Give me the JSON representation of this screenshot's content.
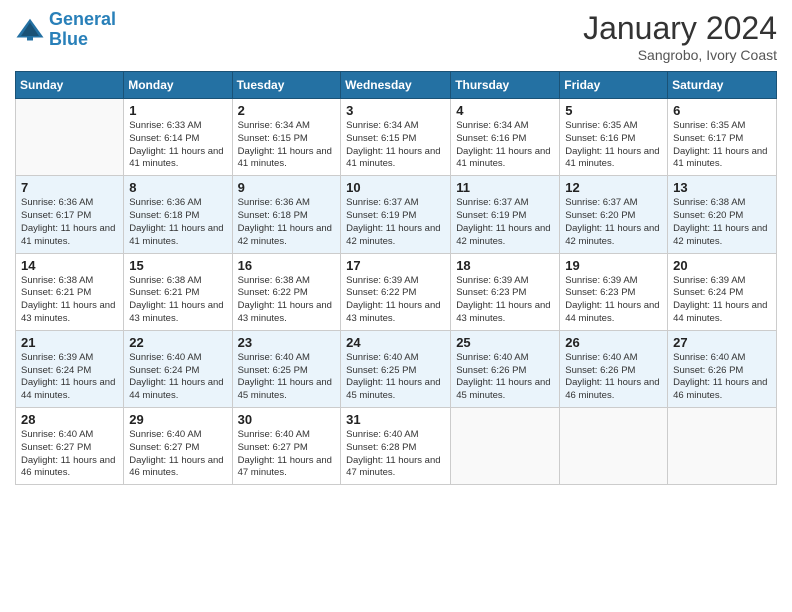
{
  "logo": {
    "line1": "General",
    "line2": "Blue"
  },
  "title": "January 2024",
  "subtitle": "Sangrobo, Ivory Coast",
  "headers": [
    "Sunday",
    "Monday",
    "Tuesday",
    "Wednesday",
    "Thursday",
    "Friday",
    "Saturday"
  ],
  "weeks": [
    {
      "shaded": false,
      "days": [
        {
          "num": "",
          "info": ""
        },
        {
          "num": "1",
          "info": "Sunrise: 6:33 AM\nSunset: 6:14 PM\nDaylight: 11 hours\nand 41 minutes."
        },
        {
          "num": "2",
          "info": "Sunrise: 6:34 AM\nSunset: 6:15 PM\nDaylight: 11 hours\nand 41 minutes."
        },
        {
          "num": "3",
          "info": "Sunrise: 6:34 AM\nSunset: 6:15 PM\nDaylight: 11 hours\nand 41 minutes."
        },
        {
          "num": "4",
          "info": "Sunrise: 6:34 AM\nSunset: 6:16 PM\nDaylight: 11 hours\nand 41 minutes."
        },
        {
          "num": "5",
          "info": "Sunrise: 6:35 AM\nSunset: 6:16 PM\nDaylight: 11 hours\nand 41 minutes."
        },
        {
          "num": "6",
          "info": "Sunrise: 6:35 AM\nSunset: 6:17 PM\nDaylight: 11 hours\nand 41 minutes."
        }
      ]
    },
    {
      "shaded": true,
      "days": [
        {
          "num": "7",
          "info": "Sunrise: 6:36 AM\nSunset: 6:17 PM\nDaylight: 11 hours\nand 41 minutes."
        },
        {
          "num": "8",
          "info": "Sunrise: 6:36 AM\nSunset: 6:18 PM\nDaylight: 11 hours\nand 41 minutes."
        },
        {
          "num": "9",
          "info": "Sunrise: 6:36 AM\nSunset: 6:18 PM\nDaylight: 11 hours\nand 42 minutes."
        },
        {
          "num": "10",
          "info": "Sunrise: 6:37 AM\nSunset: 6:19 PM\nDaylight: 11 hours\nand 42 minutes."
        },
        {
          "num": "11",
          "info": "Sunrise: 6:37 AM\nSunset: 6:19 PM\nDaylight: 11 hours\nand 42 minutes."
        },
        {
          "num": "12",
          "info": "Sunrise: 6:37 AM\nSunset: 6:20 PM\nDaylight: 11 hours\nand 42 minutes."
        },
        {
          "num": "13",
          "info": "Sunrise: 6:38 AM\nSunset: 6:20 PM\nDaylight: 11 hours\nand 42 minutes."
        }
      ]
    },
    {
      "shaded": false,
      "days": [
        {
          "num": "14",
          "info": "Sunrise: 6:38 AM\nSunset: 6:21 PM\nDaylight: 11 hours\nand 43 minutes."
        },
        {
          "num": "15",
          "info": "Sunrise: 6:38 AM\nSunset: 6:21 PM\nDaylight: 11 hours\nand 43 minutes."
        },
        {
          "num": "16",
          "info": "Sunrise: 6:38 AM\nSunset: 6:22 PM\nDaylight: 11 hours\nand 43 minutes."
        },
        {
          "num": "17",
          "info": "Sunrise: 6:39 AM\nSunset: 6:22 PM\nDaylight: 11 hours\nand 43 minutes."
        },
        {
          "num": "18",
          "info": "Sunrise: 6:39 AM\nSunset: 6:23 PM\nDaylight: 11 hours\nand 43 minutes."
        },
        {
          "num": "19",
          "info": "Sunrise: 6:39 AM\nSunset: 6:23 PM\nDaylight: 11 hours\nand 44 minutes."
        },
        {
          "num": "20",
          "info": "Sunrise: 6:39 AM\nSunset: 6:24 PM\nDaylight: 11 hours\nand 44 minutes."
        }
      ]
    },
    {
      "shaded": true,
      "days": [
        {
          "num": "21",
          "info": "Sunrise: 6:39 AM\nSunset: 6:24 PM\nDaylight: 11 hours\nand 44 minutes."
        },
        {
          "num": "22",
          "info": "Sunrise: 6:40 AM\nSunset: 6:24 PM\nDaylight: 11 hours\nand 44 minutes."
        },
        {
          "num": "23",
          "info": "Sunrise: 6:40 AM\nSunset: 6:25 PM\nDaylight: 11 hours\nand 45 minutes."
        },
        {
          "num": "24",
          "info": "Sunrise: 6:40 AM\nSunset: 6:25 PM\nDaylight: 11 hours\nand 45 minutes."
        },
        {
          "num": "25",
          "info": "Sunrise: 6:40 AM\nSunset: 6:26 PM\nDaylight: 11 hours\nand 45 minutes."
        },
        {
          "num": "26",
          "info": "Sunrise: 6:40 AM\nSunset: 6:26 PM\nDaylight: 11 hours\nand 46 minutes."
        },
        {
          "num": "27",
          "info": "Sunrise: 6:40 AM\nSunset: 6:26 PM\nDaylight: 11 hours\nand 46 minutes."
        }
      ]
    },
    {
      "shaded": false,
      "days": [
        {
          "num": "28",
          "info": "Sunrise: 6:40 AM\nSunset: 6:27 PM\nDaylight: 11 hours\nand 46 minutes."
        },
        {
          "num": "29",
          "info": "Sunrise: 6:40 AM\nSunset: 6:27 PM\nDaylight: 11 hours\nand 46 minutes."
        },
        {
          "num": "30",
          "info": "Sunrise: 6:40 AM\nSunset: 6:27 PM\nDaylight: 11 hours\nand 47 minutes."
        },
        {
          "num": "31",
          "info": "Sunrise: 6:40 AM\nSunset: 6:28 PM\nDaylight: 11 hours\nand 47 minutes."
        },
        {
          "num": "",
          "info": ""
        },
        {
          "num": "",
          "info": ""
        },
        {
          "num": "",
          "info": ""
        }
      ]
    }
  ]
}
